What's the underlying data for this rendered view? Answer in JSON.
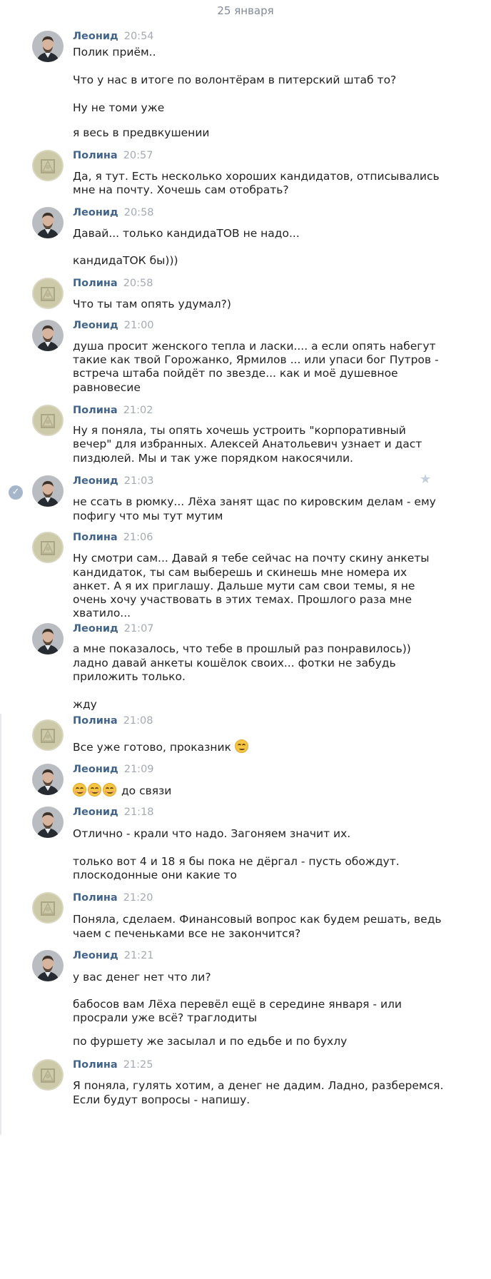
{
  "date_separator": "25 января",
  "messages": [
    {
      "author": "Леонид",
      "time": "20:54",
      "lines": [
        "Полик приём..",
        "",
        "Что у нас в итоге по волонтёрам в питерский штаб то?",
        "",
        "Ну не томи уже",
        "",
        "я весь в предвкушении"
      ]
    },
    {
      "author": "Полина",
      "time": "20:57",
      "lines": [
        "Да, я тут. Есть несколько хороших кандидатов, отписывались",
        "мне на почту. Хочешь сам отобрать?"
      ]
    },
    {
      "author": "Леонид",
      "time": "20:58",
      "lines": [
        "Давай... только кандидаТОВ не надо...",
        "",
        "кандидаТОК бы)))"
      ]
    },
    {
      "author": "Полина",
      "time": "20:58",
      "lines": [
        "Что ты там опять удумал?)"
      ]
    },
    {
      "author": "Леонид",
      "time": "21:00",
      "lines": [
        "душа просит женского тепла и ласки.... а если опять набегут",
        "такие как твой Горожанко, Ярмилов ... или упаси бог Путров -",
        "встреча штаба пойдёт по звезде... как и моё душевное",
        "равновесие"
      ]
    },
    {
      "author": "Полина",
      "time": "21:02",
      "lines": [
        "Ну я поняла, ты опять хочешь устроить \"корпоративный",
        "вечер\" для избранных. Алексей Анатольевич узнает и даст",
        "пиздюлей. Мы и так уже порядком накосячили."
      ]
    },
    {
      "author": "Леонид",
      "time": "21:03",
      "lines": [
        "не ссать в рюмку... Лёха занят щас по кировским делам - ему",
        "пофигу что мы тут мутим"
      ]
    },
    {
      "author": "Полина",
      "time": "21:06",
      "lines": [
        "Ну смотри сам... Давай я тебе сейчас на почту скину анкеты",
        "кандидаток, ты сам выберешь и скинешь мне номера их",
        "анкет. А я их приглашу. Дальше мути сам свои темы, я не",
        "очень хочу участвовать в этих темах. Прошлого раза мне",
        "хватило..."
      ]
    },
    {
      "author": "Леонид",
      "time": "21:07",
      "lines": [
        "а мне показалось, что тебе в прошлый раз понравилось))",
        "ладно давай анкеты кошёлок своих... фотки не забудь",
        "приложить только.",
        "",
        "жду"
      ]
    },
    {
      "author": "Полина",
      "time": "21:08",
      "lines": [
        "Все уже готово, проказник"
      ]
    },
    {
      "author": "Леонид",
      "time": "21:09",
      "lines": [
        "до связи"
      ]
    },
    {
      "author": "Леонид",
      "time": "21:18",
      "lines": [
        "Отлично - крали что надо. Загоняем значит их.",
        "",
        "только вот 4 и 18 я бы пока не дёргал - пусть обождут.",
        "плоскодонные они какие то"
      ]
    },
    {
      "author": "Полина",
      "time": "21:20",
      "lines": [
        "Поняла, сделаем. Финансовый вопрос как будем решать, ведь",
        "чаем с печеньками все не закончится?"
      ]
    },
    {
      "author": "Леонид",
      "time": "21:21",
      "lines": [
        "у вас денег нет что ли?",
        "",
        "бабосов вам Лёха перевёл ещё в середине января - или",
        "просрали уже всё? траглодиты",
        "",
        "по фуршету же засылал и по едьбе и по бухлу"
      ]
    },
    {
      "author": "Полина",
      "time": "21:25",
      "lines": [
        "Я поняла, гулять хотим, а денег не дадим. Ладно, разберемся.",
        "Если будут вопросы - напишу."
      ]
    }
  ]
}
